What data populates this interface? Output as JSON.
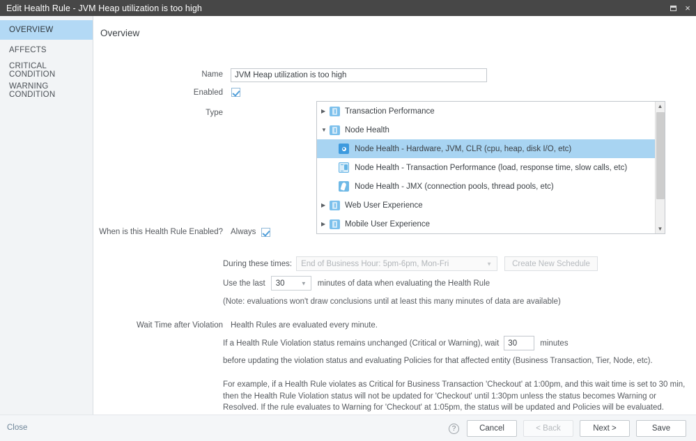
{
  "window": {
    "title": "Edit Health Rule - JVM Heap utilization is too high",
    "maximize_label": "maximize-icon",
    "close_label": "×"
  },
  "sidebar": {
    "items": [
      {
        "label": "OVERVIEW",
        "active": true
      },
      {
        "label": "AFFECTS",
        "active": false
      },
      {
        "label": "CRITICAL CONDITION",
        "active": false
      },
      {
        "label": "WARNING CONDITION",
        "active": false
      }
    ]
  },
  "main": {
    "section_title": "Overview",
    "fields": {
      "name_label": "Name",
      "name_value": "JVM Heap utilization is too high",
      "enabled_label": "Enabled",
      "enabled_checked": true,
      "type_label": "Type"
    },
    "tree": {
      "nodes": [
        {
          "label": "Transaction Performance",
          "icon": "folder-icon",
          "arrow": "▶",
          "level": 0,
          "selected": false
        },
        {
          "label": "Node Health",
          "icon": "folder-icon",
          "arrow": "▼",
          "level": 0,
          "selected": false
        },
        {
          "label": "Node Health - Hardware, JVM, CLR (cpu, heap, disk I/O, etc)",
          "icon": "target-dot-icon",
          "arrow": "",
          "level": 1,
          "selected": true
        },
        {
          "label": "Node Health - Transaction Performance (load, response time, slow calls, etc)",
          "icon": "report-icon",
          "arrow": "",
          "level": 1,
          "selected": false
        },
        {
          "label": "Node Health - JMX (connection pools, thread pools, etc)",
          "icon": "pencil-icon",
          "arrow": "",
          "level": 1,
          "selected": false
        },
        {
          "label": "Web User Experience",
          "icon": "folder-icon",
          "arrow": "▶",
          "level": 0,
          "selected": false
        },
        {
          "label": "Mobile User Experience",
          "icon": "folder-icon",
          "arrow": "▶",
          "level": 0,
          "selected": false
        }
      ],
      "scroll_up": "▲",
      "scroll_down": "▼"
    },
    "schedule": {
      "label": "When is this Health Rule Enabled?",
      "always_label": "Always",
      "always_checked": true,
      "during_label": "During these times:",
      "during_value": "End of Business Hour: 5pm-6pm, Mon-Fri",
      "create_schedule_label": "Create New Schedule",
      "use_last_prefix": "Use the last",
      "use_last_value": "30",
      "use_last_suffix": "minutes of data when evaluating the Health Rule",
      "note": "(Note: evaluations won't draw conclusions until at least this many minutes of data are available)"
    },
    "wait": {
      "label": "Wait Time after Violation",
      "line1": "Health Rules are evaluated every minute.",
      "line2_prefix": "If a Health Rule Violation status remains unchanged (Critical or Warning), wait",
      "wait_value": "30",
      "line2_suffix": "minutes",
      "line3": "before updating the violation status and evaluating Policies for that affected entity (Business Transaction, Tier, Node, etc).",
      "example": "For example, if a Health Rule violates as Critical for Business Transaction 'Checkout' at 1:00pm, and this wait time is set to 30 min, then the Health Rule Violation status will not be updated for 'Checkout' until 1:30pm unless the status becomes Warning or Resolved. If the rule evaluates to Warning for 'Checkout' at 1:05pm, the status will be updated and Policies will be evaluated."
    }
  },
  "footer": {
    "close_label": "Close",
    "help_label": "?",
    "cancel_label": "Cancel",
    "back_label": "< Back",
    "next_label": "Next >",
    "save_label": "Save"
  },
  "colors": {
    "titlebar_bg": "#474747",
    "sidebar_active": "#b3d9f5",
    "tree_selected": "#a8d4f2",
    "accent_blue": "#4f9ed9",
    "link": "#6e8598"
  }
}
